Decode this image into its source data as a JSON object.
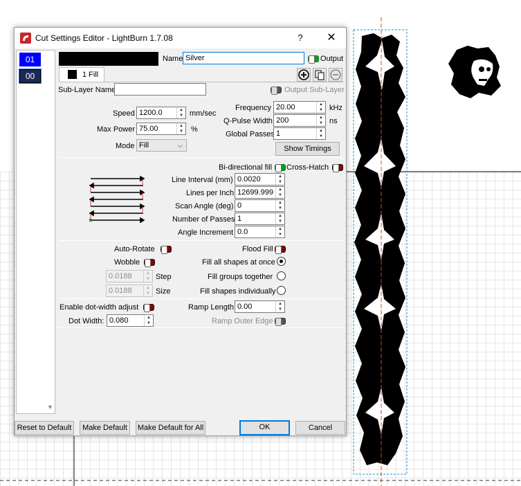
{
  "window": {
    "title": "Cut Settings Editor - LightBurn 1.7.08",
    "help": "?",
    "close": "✕"
  },
  "layers": [
    {
      "label": "01",
      "color": "#0000ff"
    },
    {
      "label": "00",
      "color": "#1a2a55"
    }
  ],
  "header": {
    "name_label": "Name",
    "name_value": "Silver",
    "output_label": "Output",
    "output_on": true
  },
  "tabs": [
    {
      "label": "1 Fill"
    }
  ],
  "sublayer": {
    "label": "Sub-Layer Name",
    "value": "",
    "output_label": "Output Sub-Layer"
  },
  "basic": {
    "speed_label": "Speed",
    "speed_value": "1200.0",
    "speed_unit": "mm/sec",
    "power_label": "Max Power",
    "power_value": "75.00",
    "power_unit": "%",
    "mode_label": "Mode",
    "mode_value": "Fill",
    "frequency_label": "Frequency",
    "frequency_value": "20.00",
    "frequency_unit": "kHz",
    "qpulse_label": "Q-Pulse Width",
    "qpulse_value": "200",
    "qpulse_unit": "ns",
    "passes_label": "Global Passes",
    "passes_value": "1",
    "show_timings": "Show Timings"
  },
  "fill": {
    "bidir_label": "Bi-directional fill",
    "bidir_on": true,
    "crosshatch_label": "Cross-Hatch",
    "crosshatch_on": false,
    "interval_label": "Line Interval (mm)",
    "interval_value": "0.0020",
    "lpi_label": "Lines per Inch",
    "lpi_value": "12699.999",
    "angle_label": "Scan Angle (deg)",
    "angle_value": "0",
    "numpasses_label": "Number of Passes",
    "numpasses_value": "1",
    "increment_label": "Angle Increment",
    "increment_value": "0.0"
  },
  "options": {
    "autorotate_label": "Auto-Rotate",
    "wobble_label": "Wobble",
    "step_value": "0.0188",
    "step_label": "Step",
    "size_value": "0.0188",
    "size_label": "Size",
    "floodfill_label": "Flood Fill",
    "fill_all_label": "Fill all shapes at once",
    "fill_groups_label": "Fill groups together",
    "fill_individually_label": "Fill shapes individually",
    "selected_fill_mode": "Fill all shapes at once"
  },
  "dot": {
    "dotwidth_adjust_label": "Enable dot-width adjust",
    "dotwidth_label": "Dot Width:",
    "dotwidth_value": "0.080",
    "ramp_label": "Ramp Length",
    "ramp_value": "0.00",
    "ramp_outer_label": "Ramp Outer Edge"
  },
  "footer": {
    "reset": "Reset to Default",
    "make_default": "Make Default",
    "make_default_all": "Make Default for All",
    "ok": "OK",
    "cancel": "Cancel"
  },
  "colors": {
    "accent": "#0078d7",
    "toggle_on": "#0a9d20",
    "toggle_off": "#7a0a0a",
    "guide_red": "#e04020",
    "selection_blue": "#1a8fd0"
  }
}
